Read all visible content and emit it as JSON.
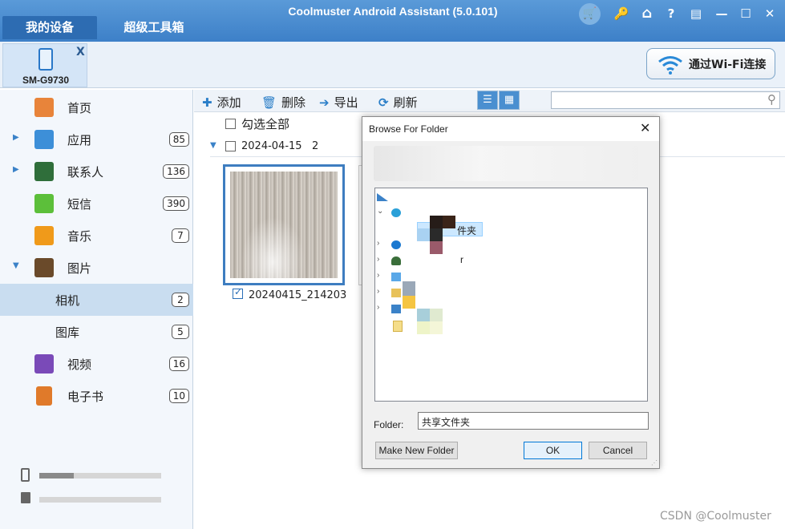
{
  "app": {
    "title": "Coolmuster Android Assistant (5.0.101)",
    "tabs": [
      "我的设备",
      "超级工具箱"
    ],
    "titlebar_icons": [
      "cart-icon",
      "key-icon",
      "home-icon",
      "help-icon",
      "feedback-icon",
      "minimize-icon",
      "maximize-icon",
      "close-icon"
    ],
    "titlebar_glyphs": [
      "🛒",
      "🔑",
      "⌂",
      "?",
      "▤",
      "—",
      "☐",
      "✕"
    ]
  },
  "device": {
    "name": "SM-G9730",
    "close": "X"
  },
  "wifi_button": {
    "label": "通过Wi-Fi连接"
  },
  "sidebar": {
    "items": [
      {
        "label": "首页",
        "count": null,
        "icon": "home-icon",
        "color": "#e8843a"
      },
      {
        "label": "应用",
        "count": "85",
        "icon": "apps-icon",
        "color": "#3d8fd8"
      },
      {
        "label": "联系人",
        "count": "136",
        "icon": "contacts-icon",
        "color": "#2f6e3a"
      },
      {
        "label": "短信",
        "count": "390",
        "icon": "sms-icon",
        "color": "#5cbf3a"
      },
      {
        "label": "音乐",
        "count": "7",
        "icon": "music-icon",
        "color": "#f09a1a"
      },
      {
        "label": "图片",
        "count": null,
        "icon": "photos-icon",
        "color": "#6a4a2a"
      },
      {
        "label": "相机",
        "count": "2",
        "icon": null
      },
      {
        "label": "图库",
        "count": "5",
        "icon": null
      },
      {
        "label": "视频",
        "count": "16",
        "icon": "video-icon",
        "color": "#7a4ab8"
      },
      {
        "label": "电子书",
        "count": "10",
        "icon": "ebook-icon",
        "color": "#e07a2a"
      }
    ],
    "storage": [
      {
        "icon": "phone-storage-icon",
        "used_fraction": 0.28
      },
      {
        "icon": "sdcard-icon",
        "used_fraction": 0.0
      }
    ]
  },
  "toolbar": {
    "add": "添加",
    "delete": "删除",
    "export": "导出",
    "refresh": "刷新",
    "add_glyph": "✚",
    "delete_glyph": "🗑",
    "export_glyph": "➔",
    "refresh_glyph": "⟳",
    "search_placeholder": ""
  },
  "content": {
    "select_all": "勾选全部",
    "group_date": "2024-04-15",
    "group_count": "2",
    "photo_name": "20240415_214203"
  },
  "dialog": {
    "title": "Browse For Folder",
    "close": "✕",
    "tree_fragments": [
      "共享文件夹",
      "r"
    ],
    "tree_visible_fragments": [
      "件夹",
      "r"
    ],
    "folder_label": "Folder:",
    "folder_value": "共享文件夹",
    "make_new_folder": "Make New Folder",
    "ok": "OK",
    "cancel": "Cancel"
  },
  "watermark": "CSDN @Coolmuster"
}
